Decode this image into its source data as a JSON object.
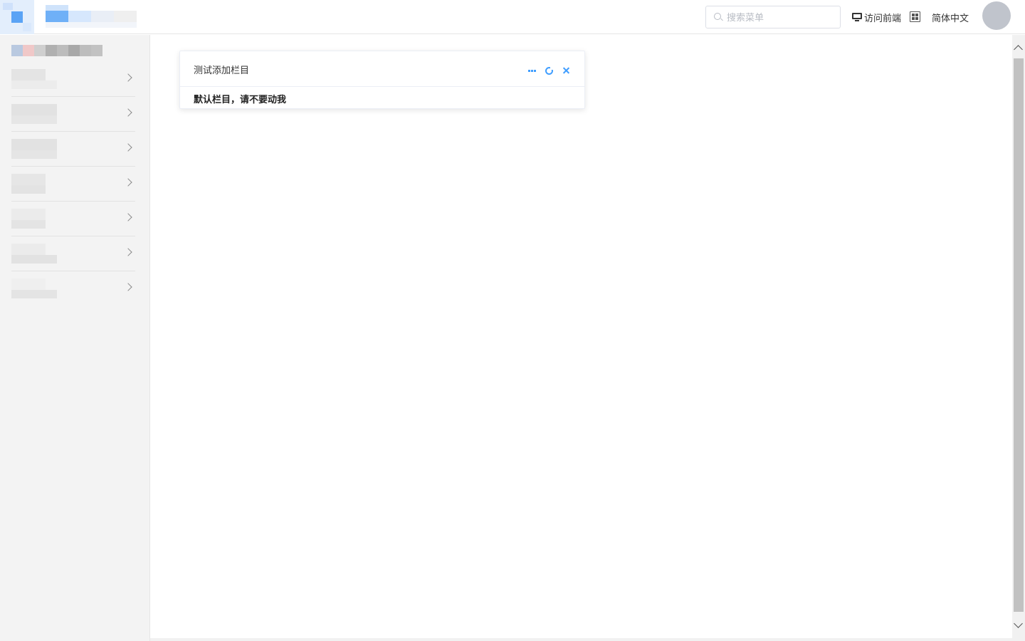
{
  "header": {
    "search_placeholder": "搜索菜单",
    "visit_frontend_label": "访问前端",
    "language_label": "简体中文"
  },
  "sidebar": {
    "items": [
      {
        "id": 1
      },
      {
        "id": 2
      },
      {
        "id": 3
      },
      {
        "id": 4
      },
      {
        "id": 5
      },
      {
        "id": 6
      },
      {
        "id": 7
      }
    ]
  },
  "card": {
    "title": "测试添加栏目",
    "body": "默认栏目，请不要动我"
  },
  "colors": {
    "accent": "#409eff",
    "sidebar_bg": "#f3f3f3",
    "avatar_bg": "#c0c4cc"
  },
  "icons": [
    "search-icon",
    "monitor-icon",
    "fullscreen-icon",
    "more-icon",
    "refresh-icon",
    "close-icon",
    "chevron-right-icon"
  ]
}
